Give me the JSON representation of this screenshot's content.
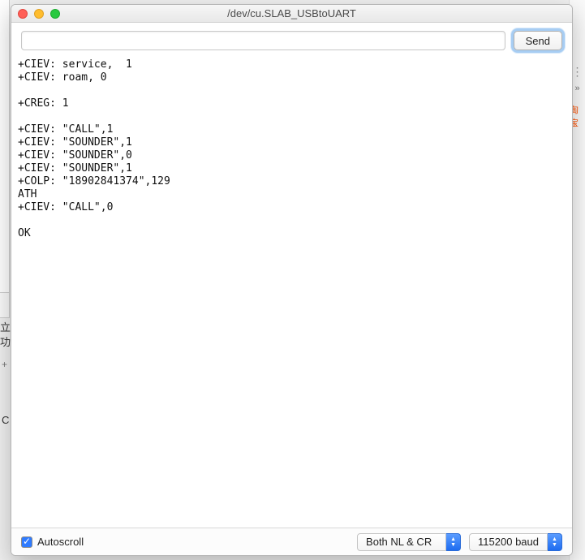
{
  "backdrop": {
    "chevrons": "»",
    "dots": "⋮",
    "taobao": "淘宝",
    "left_chars": "立\n功:",
    "left_plus": "+",
    "left_c": "C"
  },
  "window": {
    "title": "/dev/cu.SLAB_USBtoUART"
  },
  "sendRow": {
    "input_value": "",
    "input_placeholder": "",
    "send_label": "Send"
  },
  "console_text": "+CIEV: service,  1\n+CIEV: roam, 0\n\n+CREG: 1\n\n+CIEV: \"CALL\",1\n+CIEV: \"SOUNDER\",1\n+CIEV: \"SOUNDER\",0\n+CIEV: \"SOUNDER\",1\n+COLP: \"18902841374\",129\nATH\n+CIEV: \"CALL\",0\n\nOK\n",
  "footer": {
    "autoscroll_label": "Autoscroll",
    "autoscroll_checked": true,
    "line_ending_selected": "Both NL & CR",
    "baud_selected": "115200 baud"
  }
}
